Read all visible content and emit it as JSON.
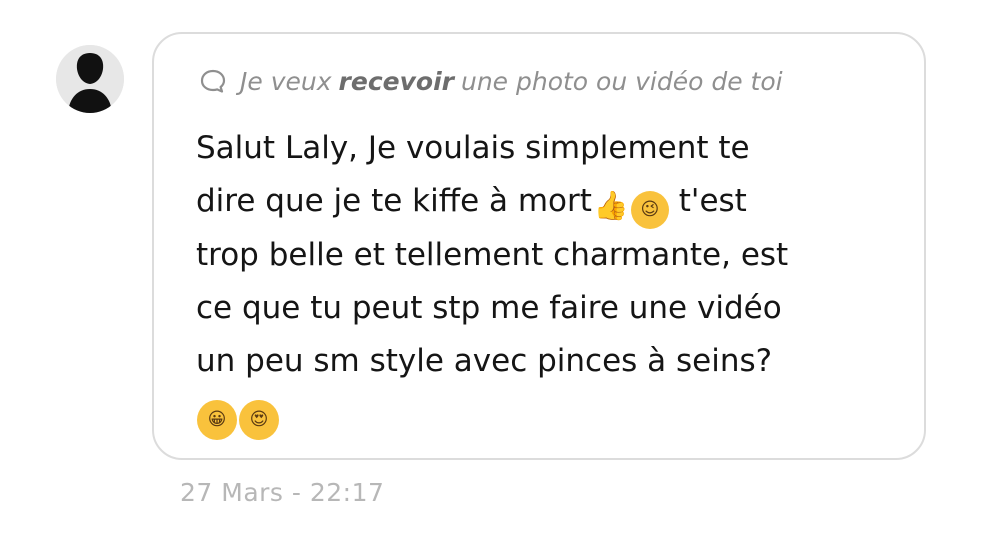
{
  "request": {
    "prefix": "Je veux",
    "emphasis": "recevoir",
    "suffix": "une photo ou vidéo de toi"
  },
  "message": {
    "line1": "Salut Laly, Je voulais simplement te",
    "line2_before": "dire que je te kiffe à mort",
    "line2_after": "t'est",
    "line3": "trop belle et tellement charmante, est",
    "line4": "ce que tu peut stp me faire une vidéo",
    "line5": "un peu sm style avec pinces à seins?"
  },
  "emojis": {
    "thumbs_up": "👍",
    "wink": "😉",
    "grin": "😀",
    "heart_eyes": "😍"
  },
  "timestamp": "27 Mars - 22:17",
  "colors": {
    "bubble_border": "#dcdcdc",
    "request_text": "#8f8f8f",
    "message_text": "#151515",
    "timestamp": "#b7b7b7",
    "emoji_yellow": "#f9c23c"
  },
  "icons": {
    "avatar": "default-person-silhouette",
    "request": "speech-bubble-icon"
  }
}
